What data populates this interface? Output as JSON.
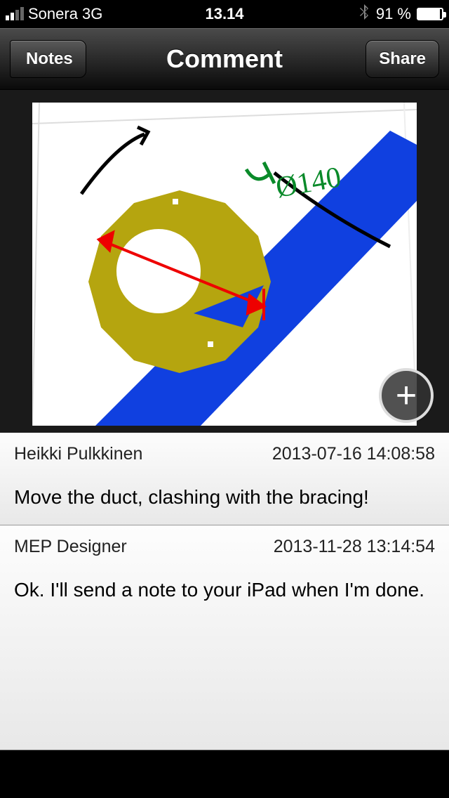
{
  "status": {
    "carrier": "Sonera",
    "network": "3G",
    "time": "13.14",
    "battery": "91 %"
  },
  "nav": {
    "back": "Notes",
    "title": "Comment",
    "share": "Share"
  },
  "addButton": "+",
  "comments": [
    {
      "author": "Heikki Pulkkinen",
      "timestamp": "2013-07-16 14:08:58",
      "body": "Move the duct, clashing with the bracing!"
    },
    {
      "author": "MEP Designer",
      "timestamp": "2013-11-28 13:14:54",
      "body": "Ok. I'll send a note to your iPad when I'm done."
    }
  ],
  "annotation": {
    "dimension_text": "Ø140"
  }
}
